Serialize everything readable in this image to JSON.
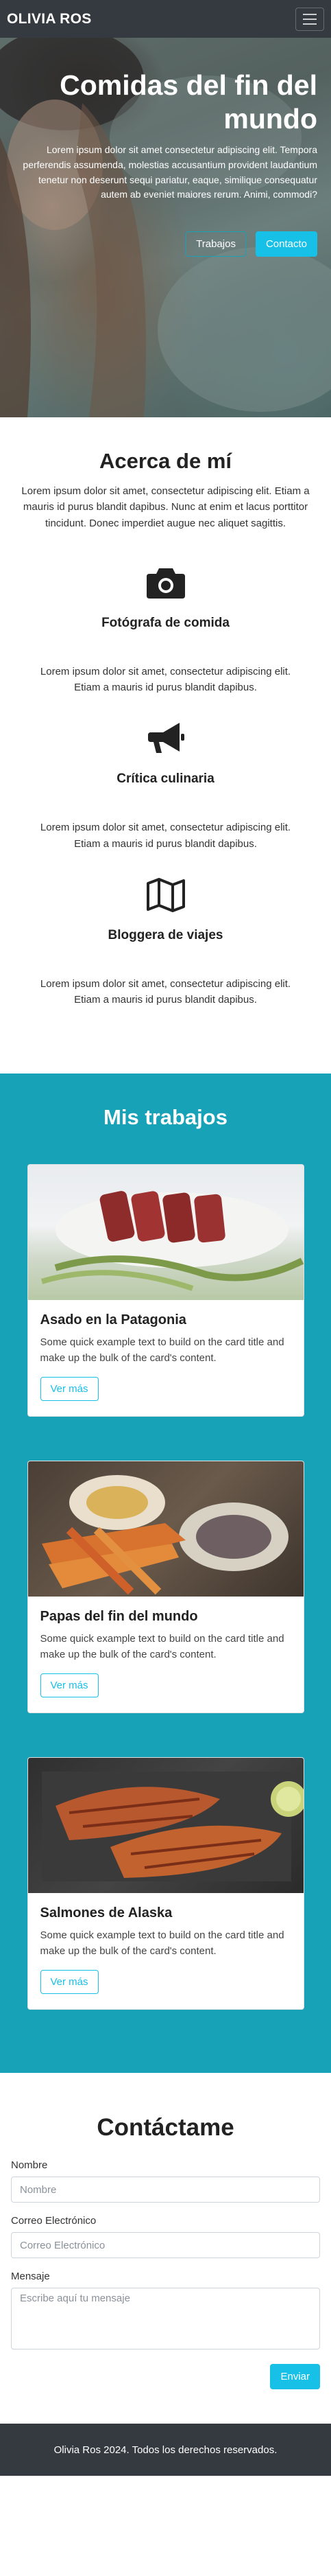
{
  "navbar": {
    "brand": "OLIVIA ROS",
    "toggle_icon": "hamburger-icon"
  },
  "hero": {
    "title": "Comidas del fin del mundo",
    "text": "Lorem ipsum dolor sit amet consectetur adipiscing elit. Tempora perferendis assumenda, molestias accusantium provident laudantium tenetur non deserunt sequi pariatur, eaque, similique consequatur autem ab eveniet maiores rerum. Animi, commodi?",
    "btn_works": "Trabajos",
    "btn_contact": "Contacto"
  },
  "about": {
    "title": "Acerca de mí",
    "intro": "Lorem ipsum dolor sit amet, consectetur adipiscing elit. Etiam a mauris id purus blandit dapibus. Nunc at enim et lacus porttitor tincidunt. Donec imperdiet augue nec aliquet sagittis.",
    "features": [
      {
        "icon": "camera-icon",
        "title": "Fotógrafa de comida",
        "text": "Lorem ipsum dolor sit amet, consectetur adipiscing elit. Etiam a mauris id purus blandit dapibus."
      },
      {
        "icon": "megaphone-icon",
        "title": "Crítica culinaria",
        "text": "Lorem ipsum dolor sit amet, consectetur adipiscing elit. Etiam a mauris id purus blandit dapibus."
      },
      {
        "icon": "map-icon",
        "title": "Bloggera de viajes",
        "text": "Lorem ipsum dolor sit amet, consectetur adipiscing elit. Etiam a mauris id purus blandit dapibus."
      }
    ]
  },
  "works": {
    "title": "Mis trabajos",
    "cards": [
      {
        "title": "Asado en la Patagonia",
        "text": "Some quick example text to build on the card title and make up the bulk of the card's content.",
        "button": "Ver más"
      },
      {
        "title": "Papas del fin del mundo",
        "text": "Some quick example text to build on the card title and make up the bulk of the card's content.",
        "button": "Ver más"
      },
      {
        "title": "Salmones de Alaska",
        "text": "Some quick example text to build on the card title and make up the bulk of the card's content.",
        "button": "Ver más"
      }
    ]
  },
  "contact": {
    "title": "Contáctame",
    "name_label": "Nombre",
    "name_placeholder": "Nombre",
    "email_label": "Correo Electrónico",
    "email_placeholder": "Correo Electrónico",
    "message_label": "Mensaje",
    "message_placeholder": "Escribe aquí tu mensaje",
    "submit": "Enviar"
  },
  "footer": {
    "text": "Olivia Ros 2024. Todos los derechos reservados."
  },
  "colors": {
    "navbar": "#343a40",
    "accent": "#17a2b8",
    "button_info": "#17c0e6"
  }
}
